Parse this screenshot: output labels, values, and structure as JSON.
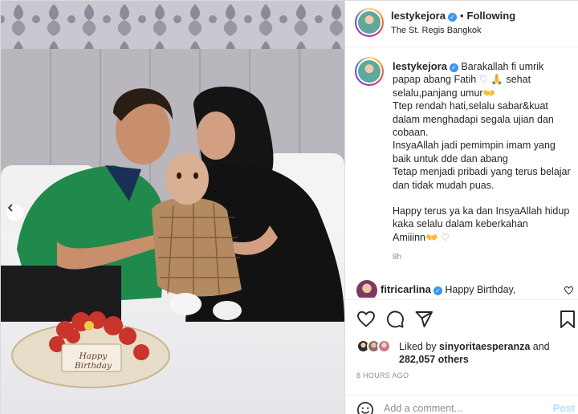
{
  "post": {
    "username": "lestykejora",
    "verified_icon": "verified-badge-icon",
    "separator": "•",
    "following_label": "Following",
    "location": "The St. Regis Bangkok",
    "caption": [
      "Barakallah fi umrik papap abang Fatih",
      "sehat selalu,panjang umur",
      "Ttep rendah hati,selalu sabar&kuat dalam menghadapi segala ujian dan cobaan.",
      "InsyaAllah jadi pemimpin imam yang baik untuk dde dan abang",
      "Tetap menjadi pribadi yang terus belajar dan tidak mudah puas.",
      "Happy terus ya ka dan InsyaAllah hidup kaka selalu dalam keberkahan",
      "Amiiinn"
    ],
    "caption_time": "8h",
    "photo_cake_label": "Happy Birthday"
  },
  "comments": [
    {
      "username": "fitricarlina",
      "text": "Happy Birthday,"
    }
  ],
  "likes": {
    "liked_by_prefix": "Liked by",
    "liked_by_user": "sinyoritaesperanza",
    "and": "and",
    "count": "282,057 others"
  },
  "post_time": "8 HOURS AGO",
  "add_comment": {
    "placeholder": "Add a comment...",
    "post_label": "Post"
  },
  "colors": {
    "verified": "#3897f0",
    "post_disabled": "#b2dffc",
    "secondary_text": "#8e8e8e"
  }
}
